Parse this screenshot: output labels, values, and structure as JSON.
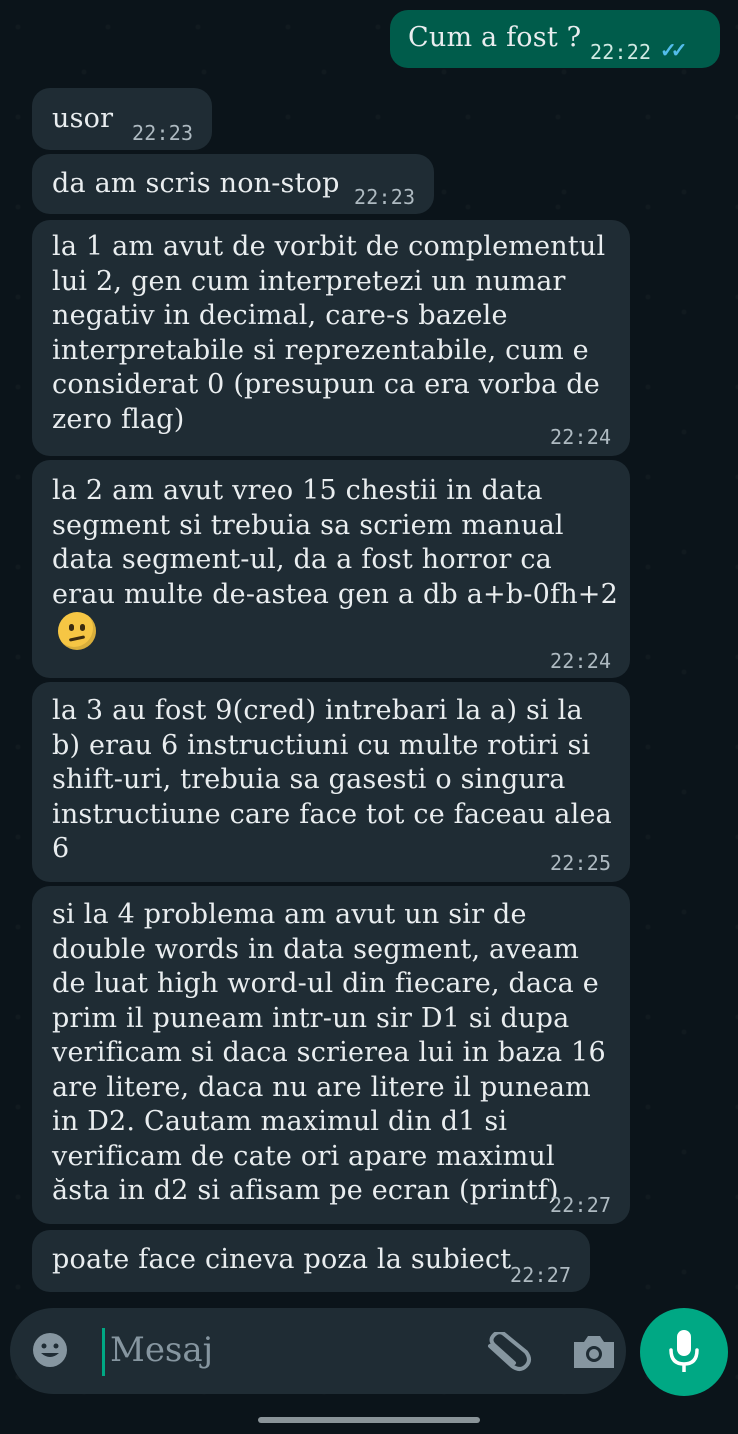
{
  "messages": [
    {
      "id": "m0",
      "direction": "out",
      "text": "Cum a fost ?",
      "time": "22:22",
      "status": "read"
    },
    {
      "id": "m1",
      "direction": "in",
      "text": "usor",
      "time": "22:23"
    },
    {
      "id": "m2",
      "direction": "in",
      "text": "da am scris non-stop",
      "time": "22:23"
    },
    {
      "id": "m3",
      "direction": "in",
      "text": "la 1 am avut de vorbit de complementul lui 2, gen cum interpretezi un numar negativ in decimal, care-s bazele interpretabile si reprezentabile, cum e considerat 0 (presupun ca era vorba de zero flag)",
      "time": "22:24"
    },
    {
      "id": "m4",
      "direction": "in",
      "text": "la 2 am avut vreo 15 chestii in data segment si trebuia sa scriem manual data segment-ul, da a fost horror ca erau multe de-astea gen a db a+b-0fh+2",
      "emoji": "confused-face",
      "time": "22:24"
    },
    {
      "id": "m5",
      "direction": "in",
      "text": "la 3 au fost 9(cred) intrebari la a) si la b) erau 6 instructiuni cu multe rotiri si shift-uri, trebuia sa gasesti o singura instructiune care face tot ce faceau alea 6",
      "time": "22:25"
    },
    {
      "id": "m6",
      "direction": "in",
      "text": "si la 4 problema am avut un sir de double words in data segment, aveam de luat high word-ul din fiecare, daca e prim il puneam intr-un sir D1 si dupa verificam si daca scrierea lui in baza 16 are litere, daca nu are litere il puneam in D2. Cautam maximul din d1 si verificam de cate ori apare maximul ăsta in d2 si afisam pe ecran (printf)",
      "time": "22:27"
    },
    {
      "id": "m7",
      "direction": "in",
      "text": "poate face cineva poza la subiect",
      "time": "22:27"
    }
  ],
  "composer": {
    "placeholder": "Mesaj",
    "icons": [
      "emoji-icon",
      "attach-icon",
      "camera-icon"
    ],
    "send_icon": "mic-icon"
  },
  "colors": {
    "background": "#0b141a",
    "incoming_bubble": "#1f2c34",
    "outgoing_bubble": "#005c4b",
    "accent": "#00a884",
    "read_ticks": "#53bdeb"
  }
}
